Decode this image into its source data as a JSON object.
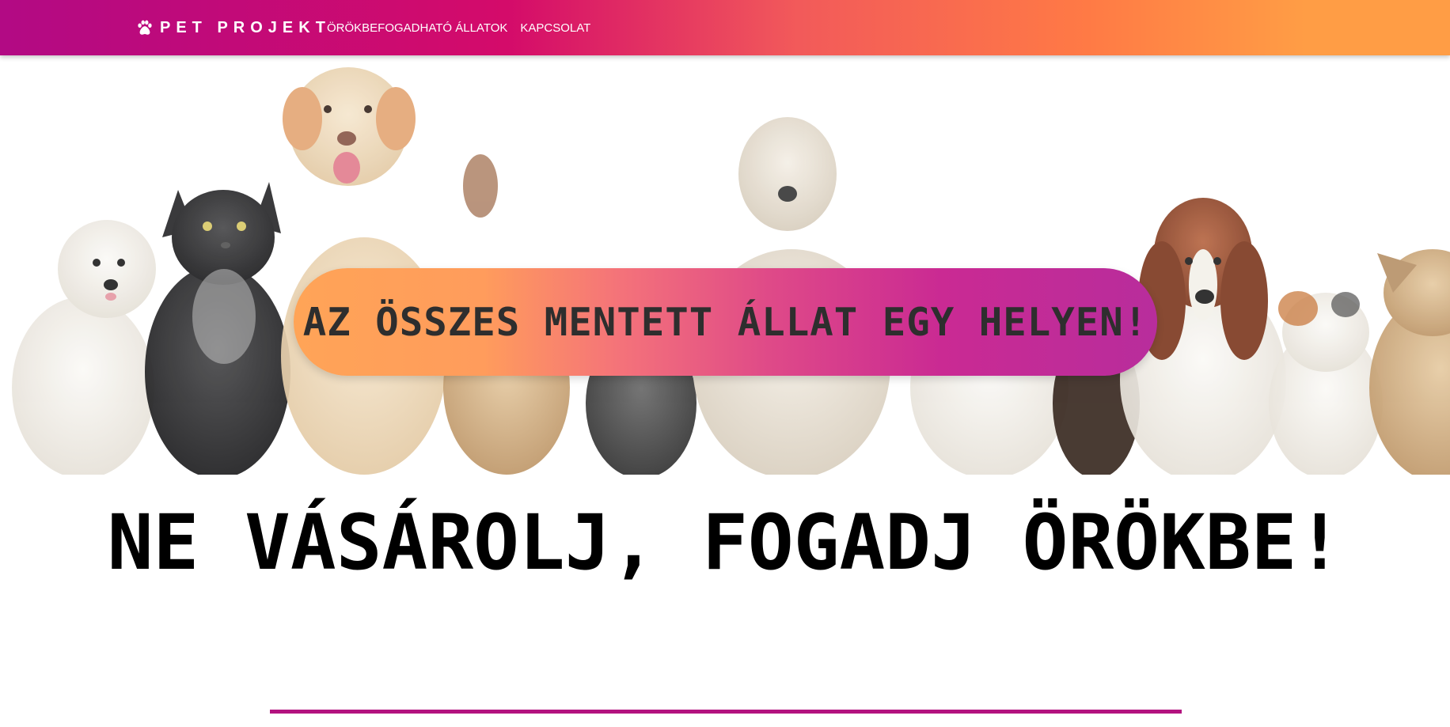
{
  "navbar": {
    "brand_icon": "paw-icon",
    "brand_name": "PET PROJEKT",
    "links": [
      {
        "label": "ÖRÖKBEFOGADHATÓ ÁLLATOK"
      },
      {
        "label": "KAPCSOLAT"
      }
    ],
    "gradient_colors": [
      "#b20a84",
      "#d40b6a",
      "#f25a5a",
      "#ff7a45",
      "#ff9d45"
    ]
  },
  "hero": {
    "image_description_icon": "pets-lineup-image",
    "tagline": "AZ ÖSSZES MENTETT ÁLLAT EGY HELYEN!",
    "pill_gradient": [
      "#ffa457",
      "#f4727a",
      "#df4a88",
      "#b82d9c"
    ]
  },
  "main": {
    "headline": "NE VÁSÁROLJ, FOGADJ ÖRÖKBE!",
    "divider_color": "#b3137f"
  }
}
